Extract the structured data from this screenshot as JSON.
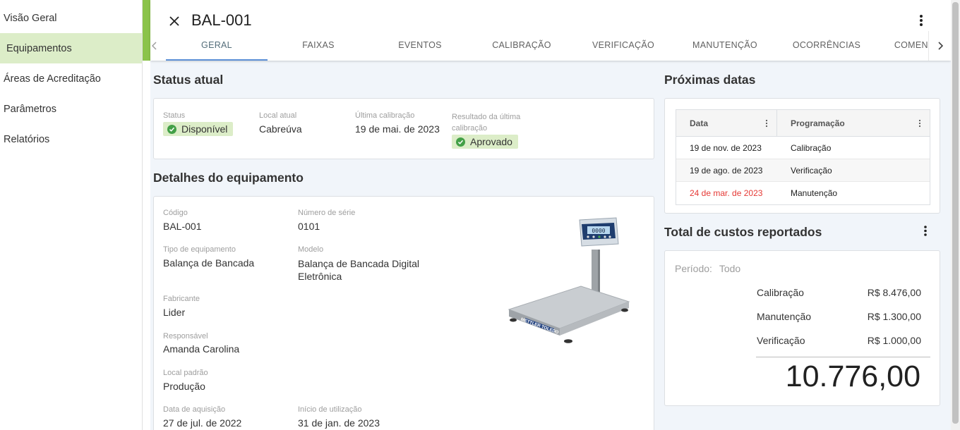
{
  "sidebar": {
    "items": [
      {
        "label": "Visão Geral"
      },
      {
        "label": "Equipamentos"
      },
      {
        "label": "Áreas de Acreditação"
      },
      {
        "label": "Parâmetros"
      },
      {
        "label": "Relatórios"
      }
    ],
    "active_index": 1
  },
  "header": {
    "title": "BAL-001",
    "tabs": [
      "GERAL",
      "FAIXAS",
      "EVENTOS",
      "CALIBRAÇÃO",
      "VERIFICAÇÃO",
      "MANUTENÇÃO",
      "OCORRÊNCIAS",
      "COMENTÁRIOS"
    ],
    "active_tab": "GERAL"
  },
  "status": {
    "section_title": "Status atual",
    "status_label": "Status",
    "status_value": "Disponível",
    "location_label": "Local atual",
    "location_value": "Cabreúva",
    "last_cal_label": "Última calibração",
    "last_cal_value": "19 de mai. de 2023",
    "last_result_label": "Resultado da última calibração",
    "last_result_value": "Aprovado"
  },
  "details": {
    "section_title": "Detalhes do equipamento",
    "code_label": "Código",
    "code_value": "BAL-001",
    "serial_label": "Número de série",
    "serial_value": "0101",
    "type_label": "Tipo de equipamento",
    "type_value": "Balança de Bancada",
    "model_label": "Modelo",
    "model_value": "Balança de Bancada Digital Eletrônica",
    "manufacturer_label": "Fabricante",
    "manufacturer_value": "Lider",
    "responsible_label": "Responsável",
    "responsible_value": "Amanda Carolina",
    "default_location_label": "Local padrão",
    "default_location_value": "Produção",
    "acquisition_label": "Data de aquisição",
    "acquisition_value": "27 de jul. de 2022",
    "usage_start_label": "Início de utilização",
    "usage_start_value": "31 de jan. de 2023",
    "image_brand": "METTLER TOLEDO",
    "image_display": "0000"
  },
  "next_dates": {
    "section_title": "Próximas datas",
    "col_date": "Data",
    "col_schedule": "Programação",
    "rows": [
      {
        "date": "19 de nov. de 2023",
        "schedule": "Calibração",
        "overdue": false
      },
      {
        "date": "19 de ago. de 2023",
        "schedule": "Verificação",
        "overdue": false
      },
      {
        "date": "24 de mar. de 2023",
        "schedule": "Manutenção",
        "overdue": true
      }
    ]
  },
  "costs": {
    "section_title": "Total de custos reportados",
    "period_label": "Período:",
    "period_value": "Todo",
    "items": [
      {
        "label": "Calibração",
        "value": "R$ 8.476,00"
      },
      {
        "label": "Manutenção",
        "value": "R$ 1.300,00"
      },
      {
        "label": "Verificação",
        "value": "R$ 1.000,00"
      }
    ],
    "total": "10.776,00"
  },
  "colors": {
    "accent_green": "#8bc34a",
    "active_nav_bg": "#dcedc8",
    "tab_indicator": "#5c8fd6",
    "overdue_red": "#e53935",
    "ok_green": "#43a047"
  }
}
